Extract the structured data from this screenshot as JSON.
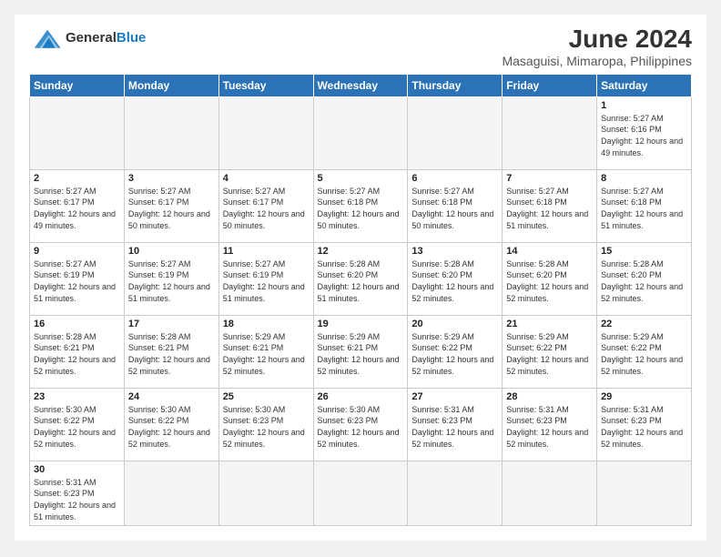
{
  "logo": {
    "line1": "General",
    "line2": "Blue"
  },
  "title": "June 2024",
  "subtitle": "Masaguisi, Mimaropa, Philippines",
  "weekdays": [
    "Sunday",
    "Monday",
    "Tuesday",
    "Wednesday",
    "Thursday",
    "Friday",
    "Saturday"
  ],
  "weeks": [
    [
      {
        "day": "",
        "info": ""
      },
      {
        "day": "",
        "info": ""
      },
      {
        "day": "",
        "info": ""
      },
      {
        "day": "",
        "info": ""
      },
      {
        "day": "",
        "info": ""
      },
      {
        "day": "",
        "info": ""
      },
      {
        "day": "1",
        "info": "Sunrise: 5:27 AM\nSunset: 6:16 PM\nDaylight: 12 hours and 49 minutes."
      }
    ],
    [
      {
        "day": "2",
        "info": "Sunrise: 5:27 AM\nSunset: 6:17 PM\nDaylight: 12 hours and 49 minutes."
      },
      {
        "day": "3",
        "info": "Sunrise: 5:27 AM\nSunset: 6:17 PM\nDaylight: 12 hours and 50 minutes."
      },
      {
        "day": "4",
        "info": "Sunrise: 5:27 AM\nSunset: 6:17 PM\nDaylight: 12 hours and 50 minutes."
      },
      {
        "day": "5",
        "info": "Sunrise: 5:27 AM\nSunset: 6:18 PM\nDaylight: 12 hours and 50 minutes."
      },
      {
        "day": "6",
        "info": "Sunrise: 5:27 AM\nSunset: 6:18 PM\nDaylight: 12 hours and 50 minutes."
      },
      {
        "day": "7",
        "info": "Sunrise: 5:27 AM\nSunset: 6:18 PM\nDaylight: 12 hours and 51 minutes."
      },
      {
        "day": "8",
        "info": "Sunrise: 5:27 AM\nSunset: 6:18 PM\nDaylight: 12 hours and 51 minutes."
      }
    ],
    [
      {
        "day": "9",
        "info": "Sunrise: 5:27 AM\nSunset: 6:19 PM\nDaylight: 12 hours and 51 minutes."
      },
      {
        "day": "10",
        "info": "Sunrise: 5:27 AM\nSunset: 6:19 PM\nDaylight: 12 hours and 51 minutes."
      },
      {
        "day": "11",
        "info": "Sunrise: 5:27 AM\nSunset: 6:19 PM\nDaylight: 12 hours and 51 minutes."
      },
      {
        "day": "12",
        "info": "Sunrise: 5:28 AM\nSunset: 6:20 PM\nDaylight: 12 hours and 51 minutes."
      },
      {
        "day": "13",
        "info": "Sunrise: 5:28 AM\nSunset: 6:20 PM\nDaylight: 12 hours and 52 minutes."
      },
      {
        "day": "14",
        "info": "Sunrise: 5:28 AM\nSunset: 6:20 PM\nDaylight: 12 hours and 52 minutes."
      },
      {
        "day": "15",
        "info": "Sunrise: 5:28 AM\nSunset: 6:20 PM\nDaylight: 12 hours and 52 minutes."
      }
    ],
    [
      {
        "day": "16",
        "info": "Sunrise: 5:28 AM\nSunset: 6:21 PM\nDaylight: 12 hours and 52 minutes."
      },
      {
        "day": "17",
        "info": "Sunrise: 5:28 AM\nSunset: 6:21 PM\nDaylight: 12 hours and 52 minutes."
      },
      {
        "day": "18",
        "info": "Sunrise: 5:29 AM\nSunset: 6:21 PM\nDaylight: 12 hours and 52 minutes."
      },
      {
        "day": "19",
        "info": "Sunrise: 5:29 AM\nSunset: 6:21 PM\nDaylight: 12 hours and 52 minutes."
      },
      {
        "day": "20",
        "info": "Sunrise: 5:29 AM\nSunset: 6:22 PM\nDaylight: 12 hours and 52 minutes."
      },
      {
        "day": "21",
        "info": "Sunrise: 5:29 AM\nSunset: 6:22 PM\nDaylight: 12 hours and 52 minutes."
      },
      {
        "day": "22",
        "info": "Sunrise: 5:29 AM\nSunset: 6:22 PM\nDaylight: 12 hours and 52 minutes."
      }
    ],
    [
      {
        "day": "23",
        "info": "Sunrise: 5:30 AM\nSunset: 6:22 PM\nDaylight: 12 hours and 52 minutes."
      },
      {
        "day": "24",
        "info": "Sunrise: 5:30 AM\nSunset: 6:22 PM\nDaylight: 12 hours and 52 minutes."
      },
      {
        "day": "25",
        "info": "Sunrise: 5:30 AM\nSunset: 6:23 PM\nDaylight: 12 hours and 52 minutes."
      },
      {
        "day": "26",
        "info": "Sunrise: 5:30 AM\nSunset: 6:23 PM\nDaylight: 12 hours and 52 minutes."
      },
      {
        "day": "27",
        "info": "Sunrise: 5:31 AM\nSunset: 6:23 PM\nDaylight: 12 hours and 52 minutes."
      },
      {
        "day": "28",
        "info": "Sunrise: 5:31 AM\nSunset: 6:23 PM\nDaylight: 12 hours and 52 minutes."
      },
      {
        "day": "29",
        "info": "Sunrise: 5:31 AM\nSunset: 6:23 PM\nDaylight: 12 hours and 52 minutes."
      }
    ],
    [
      {
        "day": "30",
        "info": "Sunrise: 5:31 AM\nSunset: 6:23 PM\nDaylight: 12 hours and 51 minutes."
      },
      {
        "day": "",
        "info": ""
      },
      {
        "day": "",
        "info": ""
      },
      {
        "day": "",
        "info": ""
      },
      {
        "day": "",
        "info": ""
      },
      {
        "day": "",
        "info": ""
      },
      {
        "day": "",
        "info": ""
      }
    ]
  ]
}
